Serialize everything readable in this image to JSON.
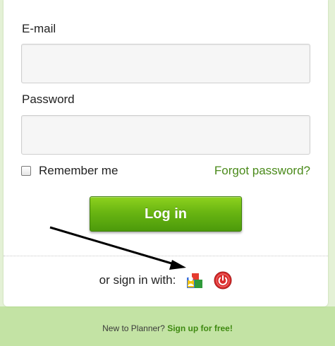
{
  "form": {
    "email_label": "E-mail",
    "email_value": "",
    "password_label": "Password",
    "password_value": "",
    "remember_label": "Remember me",
    "remember_checked": false,
    "forgot_label": "Forgot password?",
    "login_label": "Log in"
  },
  "social": {
    "prompt": "or sign in with:",
    "providers": [
      {
        "icon": "google-icon"
      },
      {
        "icon": "power-icon"
      }
    ]
  },
  "footer": {
    "text": "New to Planner?",
    "signup_label": "Sign up for free!"
  },
  "colors": {
    "accent_green": "#69b512",
    "link_green": "#4a8a1a",
    "page_background": "#c3e3a4"
  }
}
